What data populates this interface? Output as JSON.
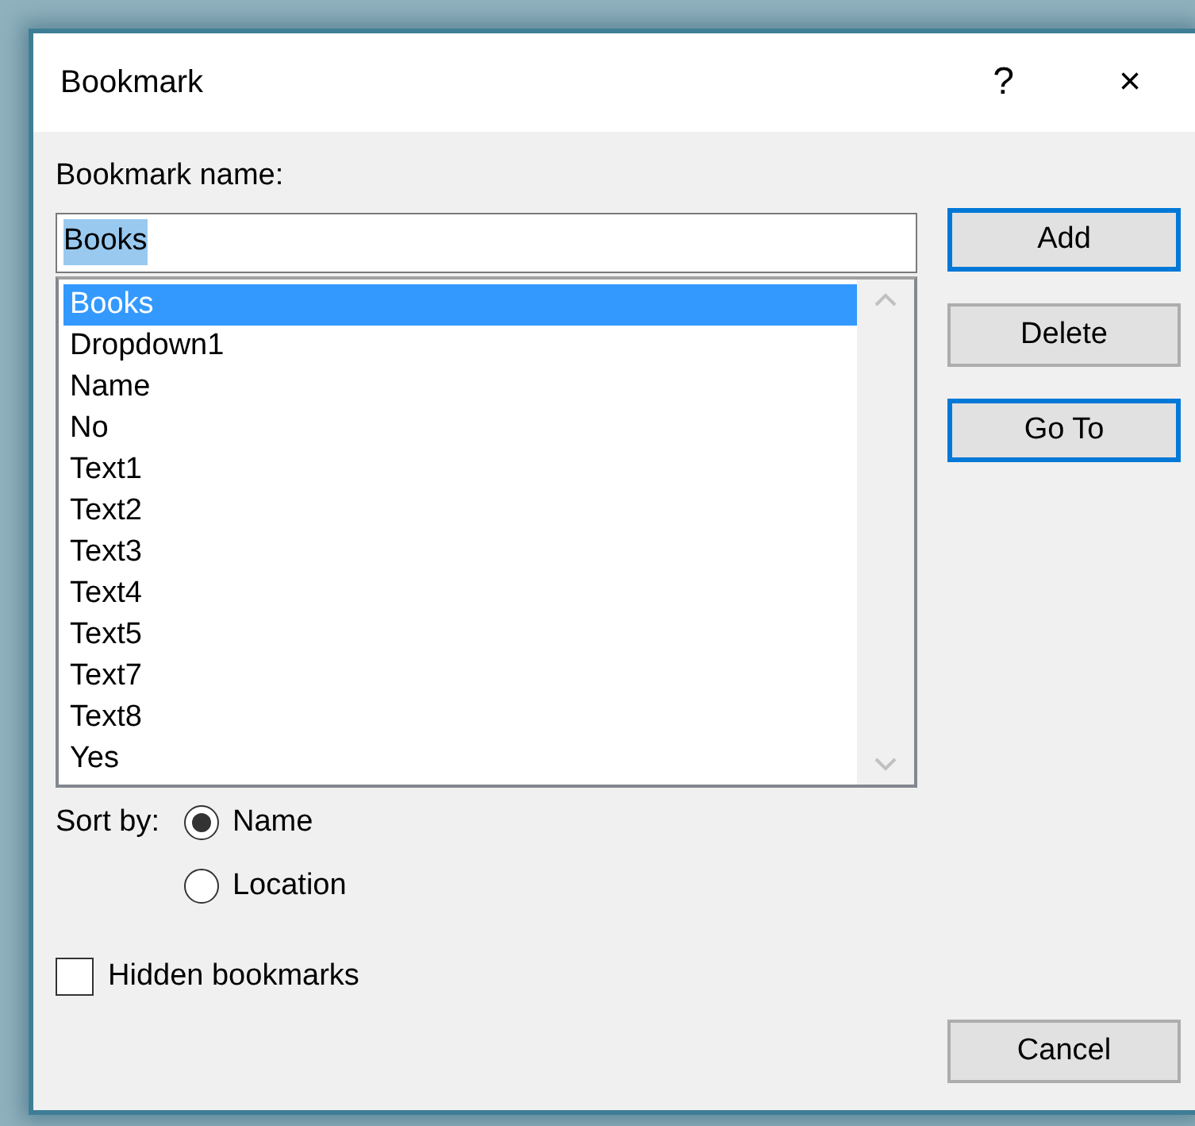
{
  "window": {
    "title": "Bookmark",
    "help_button": "?",
    "close_button": "×"
  },
  "name_field": {
    "label": "Bookmark name:",
    "value": "Books",
    "text_selected": true
  },
  "bookmarks": [
    {
      "label": "Books",
      "selected": true
    },
    {
      "label": "Dropdown1",
      "selected": false
    },
    {
      "label": "Name",
      "selected": false
    },
    {
      "label": "No",
      "selected": false
    },
    {
      "label": "Text1",
      "selected": false
    },
    {
      "label": "Text2",
      "selected": false
    },
    {
      "label": "Text3",
      "selected": false
    },
    {
      "label": "Text4",
      "selected": false
    },
    {
      "label": "Text5",
      "selected": false
    },
    {
      "label": "Text7",
      "selected": false
    },
    {
      "label": "Text8",
      "selected": false
    },
    {
      "label": "Yes",
      "selected": false
    }
  ],
  "buttons": [
    {
      "label": "Add",
      "highlighted": true
    },
    {
      "label": "Delete",
      "highlighted": false
    },
    {
      "label": "Go To",
      "highlighted": true
    }
  ],
  "sort_by": {
    "label": "Sort by:",
    "options": [
      {
        "label": "Name",
        "selected": true
      },
      {
        "label": "Location",
        "selected": false
      }
    ]
  },
  "hidden_bookmarks": {
    "label": "Hidden bookmarks",
    "checked": false
  },
  "cancel_button": {
    "label": "Cancel",
    "highlighted": false
  }
}
